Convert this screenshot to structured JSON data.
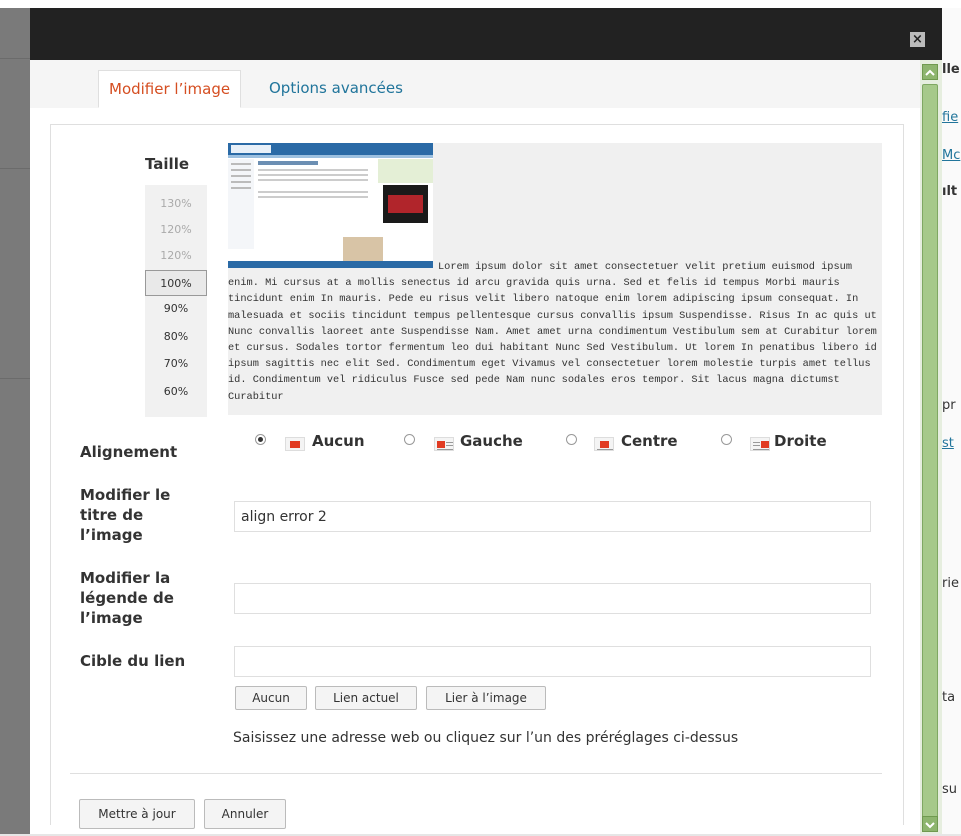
{
  "modal": {
    "close_label": "×",
    "tabs": [
      {
        "label": "Modifier l’image"
      },
      {
        "label": "Options avancées"
      }
    ]
  },
  "size": {
    "title": "Taille",
    "options": [
      "130%",
      "120%",
      "120%",
      "100%",
      "90%",
      "80%",
      "70%",
      "60%"
    ],
    "selected": "100%"
  },
  "preview": {
    "lorem": "Lorem ipsum dolor sit amet consectetuer velit pretium euismod ipsum enim. Mi cursus at a mollis senectus id arcu gravida quis urna. Sed et felis id tempus Morbi mauris tincidunt enim In mauris. Pede eu risus velit libero natoque enim lorem adipiscing ipsum consequat. In malesuada et sociis tincidunt tempus pellentesque cursus convallis ipsum Suspendisse. Risus In ac quis ut Nunc convallis laoreet ante Suspendisse Nam. Amet amet urna condimentum Vestibulum sem at Curabitur lorem et cursus. Sodales tortor fermentum leo dui habitant Nunc Sed Vestibulum. Ut lorem In penatibus libero id ipsum sagittis nec elit Sed. Condimentum eget Vivamus vel consectetuer lorem molestie turpis amet tellus id. Condimentum vel ridiculus Fusce sed pede Nam nunc sodales eros tempor. Sit lacus magna dictumst Curabitur"
  },
  "alignment": {
    "label": "Alignement",
    "options": [
      {
        "label": "Aucun",
        "checked": true
      },
      {
        "label": "Gauche",
        "checked": false
      },
      {
        "label": "Centre",
        "checked": false
      },
      {
        "label": "Droite",
        "checked": false
      }
    ]
  },
  "title_field": {
    "label_line1": "Modifier le",
    "label_line2": "titre de",
    "label_line3": "l’image",
    "value": "align error 2"
  },
  "caption_field": {
    "label_line1": "Modifier la",
    "label_line2": "légende de",
    "label_line3": "l’image",
    "value": ""
  },
  "link_field": {
    "label": "Cible du lien",
    "value": "",
    "buttons": [
      "Aucun",
      "Lien actuel",
      "Lier à l’image"
    ],
    "hint": "Saisissez une adresse web ou cliquez sur l’un des préréglages ci-dessus"
  },
  "footer": {
    "update_label": "Mettre à jour",
    "cancel_label": "Annuler"
  },
  "background_fragments": [
    "lle",
    "fie",
    "Mc",
    "ılt",
    "pr",
    "st",
    "rie",
    "ta",
    "su"
  ],
  "colors": {
    "accent_active_tab": "#d54e21",
    "link_blue": "#21759b",
    "scrollbar_green": "#a6c98a",
    "header_dark": "#222222"
  }
}
